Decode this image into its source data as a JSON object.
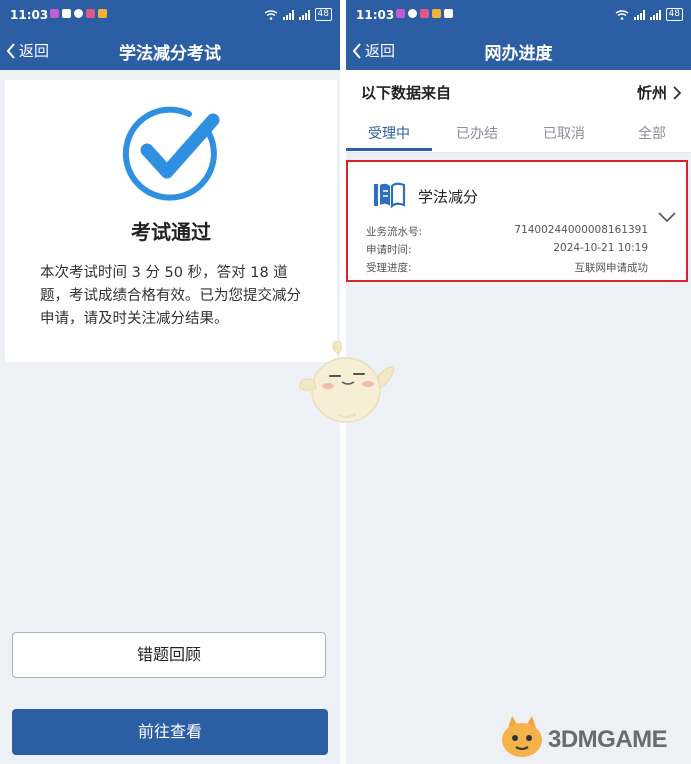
{
  "left": {
    "status": {
      "time": "11:03",
      "battery": "48"
    },
    "nav": {
      "back_label": "返回",
      "title": "学法减分考试"
    },
    "result": {
      "title": "考试通过",
      "description": "本次考试时间 3 分 50 秒，答对 18 道题，考试成绩合格有效。已为您提交减分申请，请及时关注减分结果。"
    },
    "buttons": {
      "review_label": "错题回顾",
      "view_label": "前往查看"
    }
  },
  "right": {
    "status": {
      "time": "11:03",
      "battery": "48"
    },
    "nav": {
      "back_label": "返回",
      "title": "网办进度"
    },
    "source": {
      "label": "以下数据来自",
      "city": "忻州"
    },
    "tabs": [
      {
        "label": "受理中",
        "active": true
      },
      {
        "label": "已办结",
        "active": false
      },
      {
        "label": "已取消",
        "active": false
      },
      {
        "label": "全部",
        "active": false
      }
    ],
    "application": {
      "name": "学法减分",
      "rows": [
        {
          "label": "业务流水号:",
          "value": "71400244000008161391"
        },
        {
          "label": "申请时间:",
          "value": "2024-10-21 10:19"
        },
        {
          "label": "受理进度:",
          "value": "互联网申请成功"
        }
      ]
    }
  },
  "watermark": {
    "text": "3DMGAME"
  },
  "colors": {
    "primary": "#2c5ea3",
    "accent_check": "#2f8fe3",
    "highlight_border": "#d9232a",
    "background": "#edf1f6"
  },
  "icons": [
    "chevron-left-icon",
    "check-circle-icon",
    "chevron-right-icon",
    "book-icon",
    "chevron-down-icon",
    "wifi-icon",
    "signal-icon",
    "battery-icon"
  ]
}
